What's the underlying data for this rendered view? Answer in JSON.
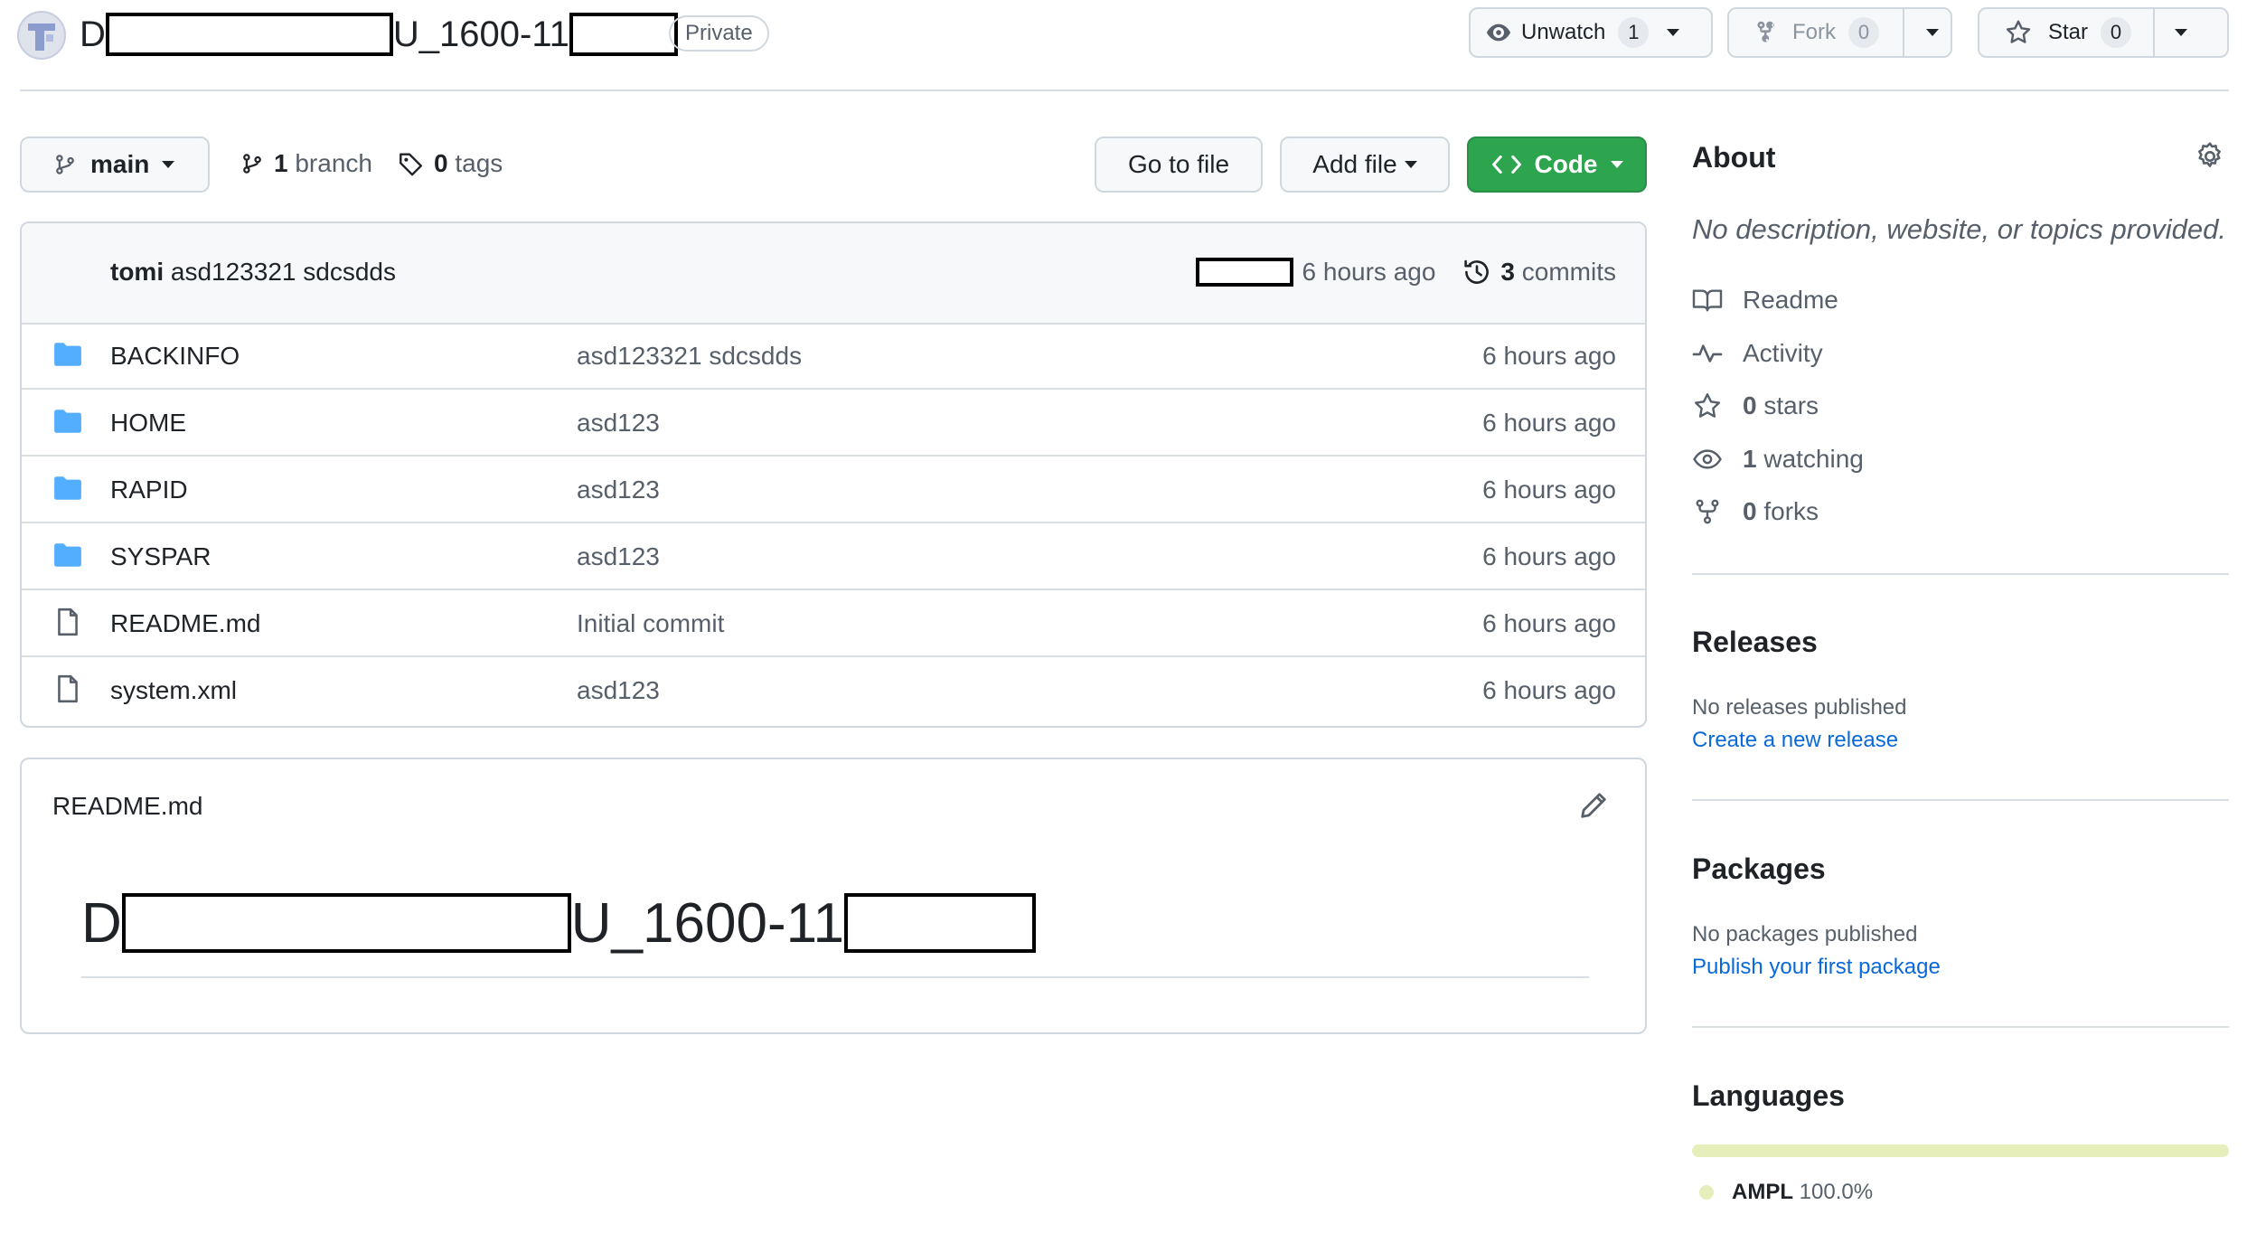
{
  "header": {
    "repo_prefix": "D",
    "repo_middle": "U_1600-11",
    "visibility": "Private",
    "unwatch_label": "Unwatch",
    "watch_count": "1",
    "fork_label": "Fork",
    "fork_count": "0",
    "star_label": "Star",
    "star_count": "0"
  },
  "toolbar": {
    "branch_name": "main",
    "branch_count": "1",
    "branch_label": "branch",
    "tag_count": "0",
    "tag_label": "tags",
    "go_to_file": "Go to file",
    "add_file": "Add file",
    "code": "Code"
  },
  "commit": {
    "author": "tomi",
    "message": "asd123321 sdcsdds",
    "time": "6 hours ago",
    "commit_count": "3",
    "commits_label": "commits"
  },
  "files": [
    {
      "type": "folder",
      "name": "BACKINFO",
      "message": "asd123321 sdcsdds",
      "time": "6 hours ago"
    },
    {
      "type": "folder",
      "name": "HOME",
      "message": "asd123",
      "time": "6 hours ago"
    },
    {
      "type": "folder",
      "name": "RAPID",
      "message": "asd123",
      "time": "6 hours ago"
    },
    {
      "type": "folder",
      "name": "SYSPAR",
      "message": "asd123",
      "time": "6 hours ago"
    },
    {
      "type": "file",
      "name": "README.md",
      "message": "Initial commit",
      "time": "6 hours ago"
    },
    {
      "type": "file",
      "name": "system.xml",
      "message": "asd123",
      "time": "6 hours ago"
    }
  ],
  "readme": {
    "filename": "README.md",
    "heading_prefix": "D",
    "heading_middle": "U_1600-11"
  },
  "about": {
    "title": "About",
    "description": "No description, website, or topics provided.",
    "readme": "Readme",
    "activity": "Activity",
    "stars_count": "0",
    "stars_label": "stars",
    "watching_count": "1",
    "watching_label": "watching",
    "forks_count": "0",
    "forks_label": "forks"
  },
  "releases": {
    "title": "Releases",
    "empty": "No releases published",
    "link": "Create a new release"
  },
  "packages": {
    "title": "Packages",
    "empty": "No packages published",
    "link": "Publish your first package"
  },
  "languages": {
    "title": "Languages",
    "items": [
      {
        "name": "AMPL",
        "percent": "100.0%",
        "color": "#e6efbb"
      }
    ]
  },
  "colors": {
    "code_button": "#2da44e",
    "link": "#0969da",
    "folder": "#54aeff"
  }
}
